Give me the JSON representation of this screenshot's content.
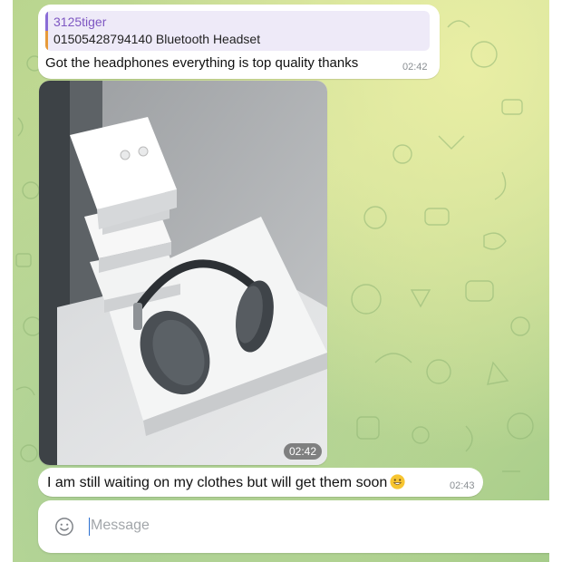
{
  "messages": [
    {
      "reply": {
        "sender": "3125tiger",
        "quoted_text": "01505428794140 Bluetooth Headset"
      },
      "text": "Got the headphones everything is top quality thanks",
      "time": "02:42"
    },
    {
      "photo_description": "white product boxes stacked next to grey over-ear headphones on a white box",
      "time": "02:42"
    },
    {
      "text": "I am still waiting on my clothes but will get them soon",
      "emoji": "smiling-face-icon",
      "time": "02:43"
    }
  ],
  "composer": {
    "placeholder": "Message",
    "icon": "emoji-icon"
  },
  "colors": {
    "bubble": "#ffffff",
    "reply_name": "#7e57c2",
    "reply_background": "#eeeaf8",
    "wallpaper": "#c2da94",
    "timestamp": "#8a8f93"
  }
}
